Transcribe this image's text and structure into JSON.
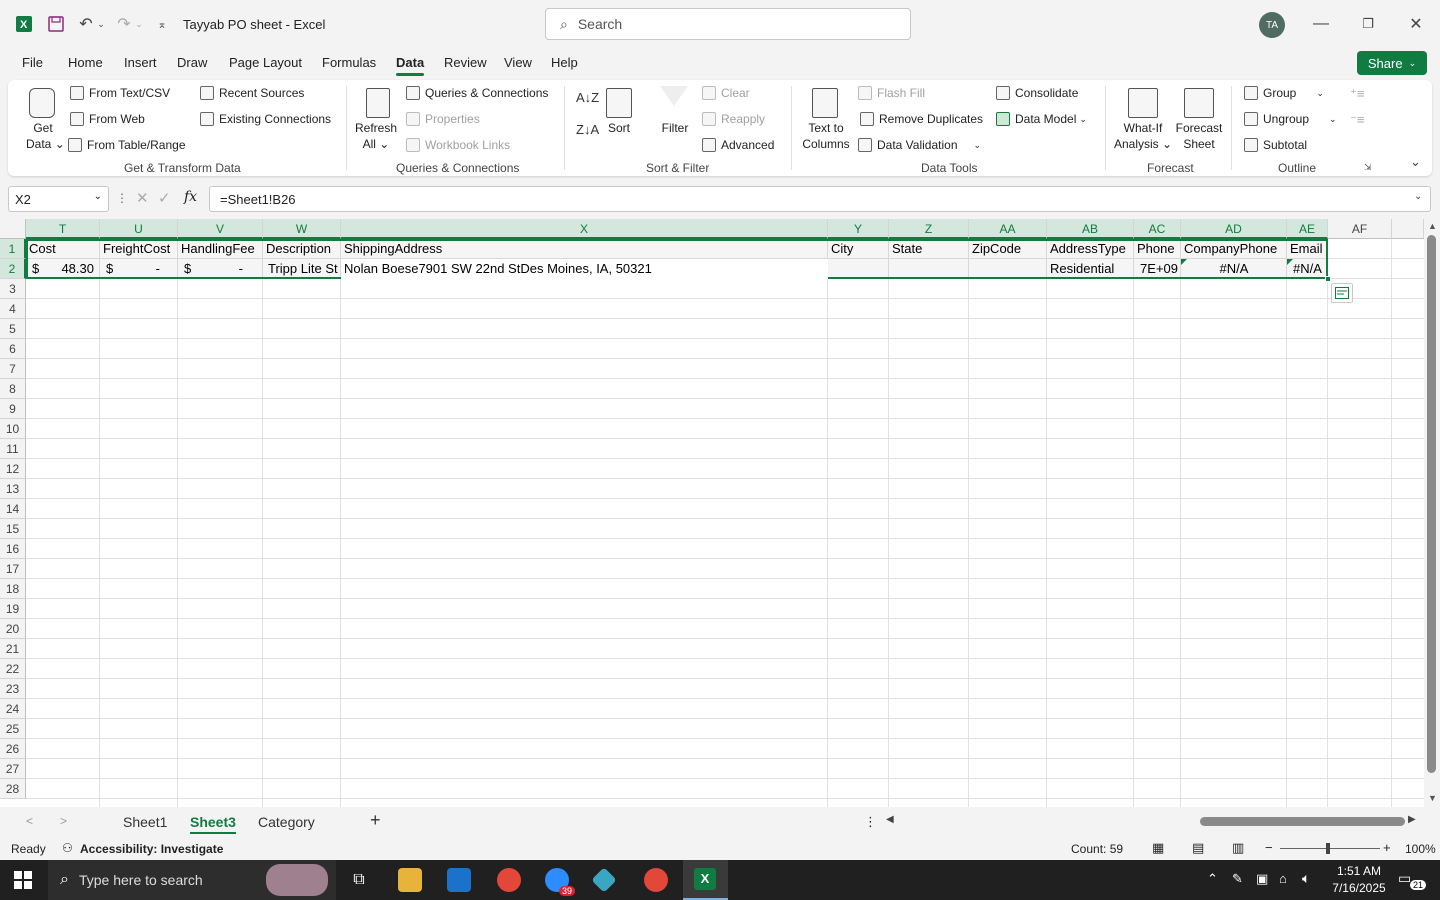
{
  "window": {
    "title": "Tayyab PO sheet  -  Excel",
    "search_placeholder": "Search",
    "avatar": "TA"
  },
  "menu": {
    "items": [
      "File",
      "Home",
      "Insert",
      "Draw",
      "Page Layout",
      "Formulas",
      "Data",
      "Review",
      "View",
      "Help"
    ],
    "active": "Data",
    "share": "Share"
  },
  "ribbon": {
    "get_transform": {
      "get_data": "Get",
      "get_data2": "Data",
      "from_text": "From Text/CSV",
      "from_web": "From Web",
      "from_table": "From Table/Range",
      "recent": "Recent Sources",
      "existing": "Existing Connections",
      "label": "Get & Transform Data"
    },
    "queries": {
      "refresh": "Refresh",
      "refresh2": "All",
      "queries_conn": "Queries & Connections",
      "properties": "Properties",
      "workbook_links": "Workbook Links",
      "label": "Queries & Connections"
    },
    "sort_filter": {
      "sort": "Sort",
      "filter": "Filter",
      "clear": "Clear",
      "reapply": "Reapply",
      "advanced": "Advanced",
      "label": "Sort & Filter"
    },
    "data_tools": {
      "text_to": "Text to",
      "columns": "Columns",
      "flash_fill": "Flash Fill",
      "remove_dup": "Remove Duplicates",
      "data_validation": "Data Validation",
      "consolidate": "Consolidate",
      "data_model": "Data Model",
      "label": "Data Tools"
    },
    "forecast": {
      "what_if": "What-If",
      "analysis": "Analysis",
      "forecast": "Forecast",
      "sheet": "Sheet",
      "label": "Forecast"
    },
    "outline": {
      "group": "Group",
      "ungroup": "Ungroup",
      "subtotal": "Subtotal",
      "label": "Outline"
    }
  },
  "formula_bar": {
    "name_box": "X2",
    "fx": "fx",
    "formula": "=Sheet1!B26"
  },
  "columns": [
    "T",
    "U",
    "V",
    "W",
    "X",
    "Y",
    "Z",
    "AA",
    "AB",
    "AC",
    "AD",
    "AE",
    "AF"
  ],
  "rows": [
    "1",
    "2",
    "3",
    "4",
    "5",
    "6",
    "7",
    "8",
    "9",
    "10",
    "11",
    "12",
    "13",
    "14",
    "15",
    "16",
    "17",
    "18",
    "19",
    "20",
    "21",
    "22",
    "23",
    "24",
    "25",
    "26",
    "27",
    "28"
  ],
  "cells": {
    "r1": [
      "Cost",
      "FreightCost",
      "HandlingFee",
      "Description",
      "ShippingAddress",
      "City",
      "State",
      "ZipCode",
      "AddressType",
      "Phone",
      "CompanyPhone",
      "Email"
    ],
    "r2": {
      "cost_sym": "$",
      "cost_val": "48.30",
      "freight_sym": "$",
      "freight_val": "-",
      "handling_sym": "$",
      "handling_val": "-",
      "description": "Tripp Lite St",
      "shipping": "Nolan Boese7901 SW 22nd StDes Moines, IA, 50321",
      "address_type": "Residential",
      "phone": "7E+09",
      "company_phone": "#N/A",
      "email": "#N/A"
    }
  },
  "sheets": {
    "tabs": [
      "Sheet1",
      "Sheet3",
      "Category"
    ],
    "active": "Sheet3",
    "add": "+"
  },
  "status": {
    "ready": "Ready",
    "accessibility": "Accessibility: Investigate",
    "count": "Count: 59",
    "zoom": "100%"
  },
  "taskbar": {
    "search": "Type here to search",
    "time": "1:51 AM",
    "date": "7/16/2025",
    "notif": "21",
    "zoom_badge": "39"
  }
}
